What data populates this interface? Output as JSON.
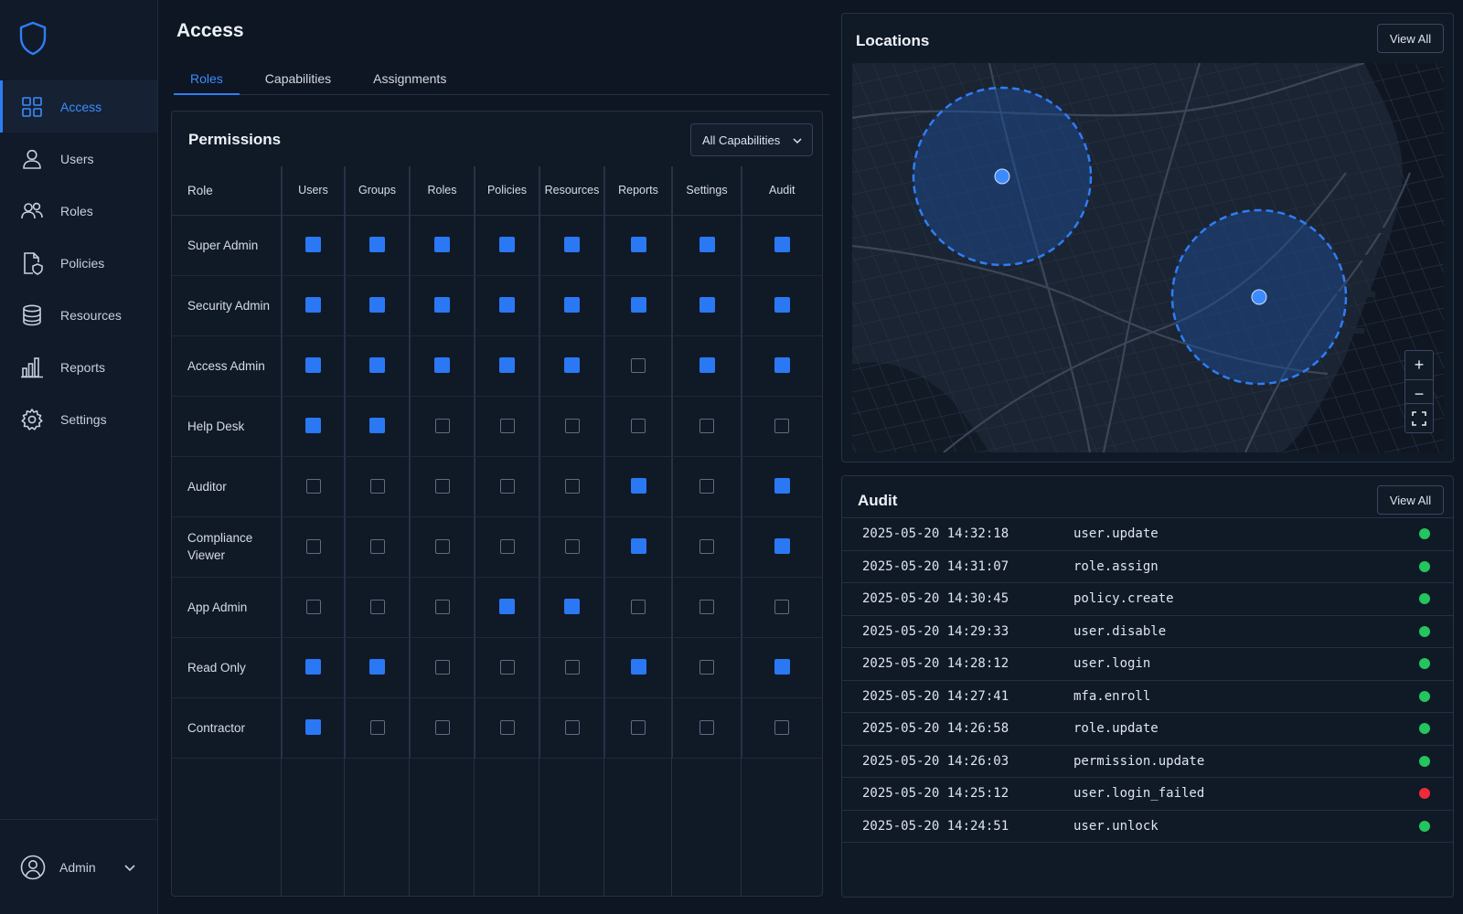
{
  "nav": {
    "items": [
      {
        "label": "Access",
        "icon": "grid-icon",
        "active": true
      },
      {
        "label": "Users",
        "icon": "user-icon",
        "active": false
      },
      {
        "label": "Roles",
        "icon": "users-group-icon",
        "active": false
      },
      {
        "label": "Policies",
        "icon": "document-shield-icon",
        "active": false
      },
      {
        "label": "Resources",
        "icon": "database-icon",
        "active": false
      },
      {
        "label": "Reports",
        "icon": "bar-chart-icon",
        "active": false
      },
      {
        "label": "Settings",
        "icon": "gear-icon",
        "active": false
      }
    ],
    "account": {
      "label": "Admin",
      "icon": "user-circle-icon"
    }
  },
  "header": {
    "title": "Access"
  },
  "tabs": [
    {
      "label": "Roles",
      "active": true
    },
    {
      "label": "Capabilities",
      "active": false
    },
    {
      "label": "Assignments",
      "active": false
    }
  ],
  "permissions": {
    "title": "Permissions",
    "filter": {
      "selected": "All Capabilities"
    },
    "role_header": "Role",
    "columns": [
      "Users",
      "Groups",
      "Roles",
      "Policies",
      "Resources",
      "Reports",
      "Settings",
      "Audit"
    ],
    "rows": [
      {
        "role": "Super Admin",
        "grants": [
          true,
          true,
          true,
          true,
          true,
          true,
          true,
          true
        ]
      },
      {
        "role": "Security Admin",
        "grants": [
          true,
          true,
          true,
          true,
          true,
          true,
          true,
          true
        ]
      },
      {
        "role": "Access Admin",
        "grants": [
          true,
          true,
          true,
          true,
          true,
          false,
          true,
          true
        ]
      },
      {
        "role": "Help Desk",
        "grants": [
          true,
          true,
          false,
          false,
          false,
          false,
          false,
          false
        ]
      },
      {
        "role": "Auditor",
        "grants": [
          false,
          false,
          false,
          false,
          false,
          true,
          false,
          true
        ]
      },
      {
        "role": "Compliance Viewer",
        "grants": [
          false,
          false,
          false,
          false,
          false,
          true,
          false,
          true
        ]
      },
      {
        "role": "App Admin",
        "grants": [
          false,
          false,
          false,
          true,
          true,
          false,
          false,
          false
        ]
      },
      {
        "role": "Read Only",
        "grants": [
          true,
          true,
          false,
          false,
          false,
          true,
          false,
          true
        ]
      },
      {
        "role": "Contractor",
        "grants": [
          true,
          false,
          false,
          false,
          false,
          false,
          false,
          false
        ]
      }
    ]
  },
  "locations": {
    "title": "Locations",
    "view_all": "View All",
    "controls": {
      "zoom_in": "+",
      "zoom_out": "−"
    }
  },
  "audit": {
    "title": "Audit",
    "view_all": "View All",
    "events": [
      {
        "time": "2025-05-20 14:32:18",
        "event": "user.update",
        "status": "success"
      },
      {
        "time": "2025-05-20 14:31:07",
        "event": "role.assign",
        "status": "success"
      },
      {
        "time": "2025-05-20 14:30:45",
        "event": "policy.create",
        "status": "success"
      },
      {
        "time": "2025-05-20 14:29:33",
        "event": "user.disable",
        "status": "success"
      },
      {
        "time": "2025-05-20 14:28:12",
        "event": "user.login",
        "status": "success"
      },
      {
        "time": "2025-05-20 14:27:41",
        "event": "mfa.enroll",
        "status": "success"
      },
      {
        "time": "2025-05-20 14:26:58",
        "event": "role.update",
        "status": "success"
      },
      {
        "time": "2025-05-20 14:26:03",
        "event": "permission.update",
        "status": "success"
      },
      {
        "time": "2025-05-20 14:25:12",
        "event": "user.login_failed",
        "status": "failure"
      },
      {
        "time": "2025-05-20 14:24:51",
        "event": "user.unlock",
        "status": "success"
      }
    ]
  },
  "colors": {
    "accent": "#2f7df6",
    "background": "#0e1623",
    "panel": "#101926",
    "success": "#22c55e",
    "failure": "#ef2b3a"
  }
}
